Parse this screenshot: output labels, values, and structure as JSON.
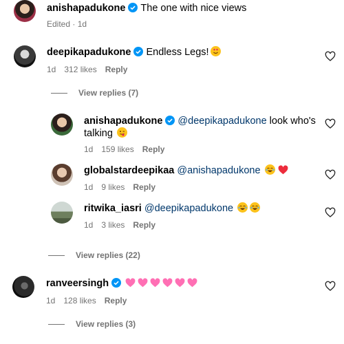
{
  "caption": {
    "username": "anishapadukone",
    "text": "The one with nice views",
    "meta": "Edited · 1d"
  },
  "comments": [
    {
      "username": "deepikapadukone",
      "text": "Endless Legs!",
      "emoji": "heart-eyes-emoji",
      "time": "1d",
      "likes": "312 likes",
      "reply": "Reply",
      "view_replies": "View replies (7)",
      "replies": [
        {
          "username": "anishapadukone",
          "mention": "@deepikapadukone",
          "text_line1": "look who's",
          "text_line2": "talking",
          "emoji": "winking-tongue-emoji",
          "time": "1d",
          "likes": "159 likes",
          "reply": "Reply"
        },
        {
          "username": "globalstardeepikaa",
          "mention": "@anishapadukone",
          "emoji": "laughing-emoji, red-heart-emoji",
          "time": "1d",
          "likes": "9 likes",
          "reply": "Reply"
        },
        {
          "username": "ritwika_iasri",
          "mention": "@deepikapadukone",
          "emoji": "laughing-emoji x2",
          "time": "1d",
          "likes": "3 likes",
          "reply": "Reply"
        }
      ],
      "more_replies": "View replies (22)"
    },
    {
      "username": "ranveersingh",
      "emoji": "pink-heart-emoji x6",
      "time": "1d",
      "likes": "128 likes",
      "reply": "Reply",
      "view_replies": "View replies (3)"
    }
  ],
  "colors": {
    "verified": "#0095f6",
    "mention": "#00376b",
    "meta": "#737373",
    "pink_heart": "#ff6fb4",
    "red_heart": "#ed2c3c"
  }
}
